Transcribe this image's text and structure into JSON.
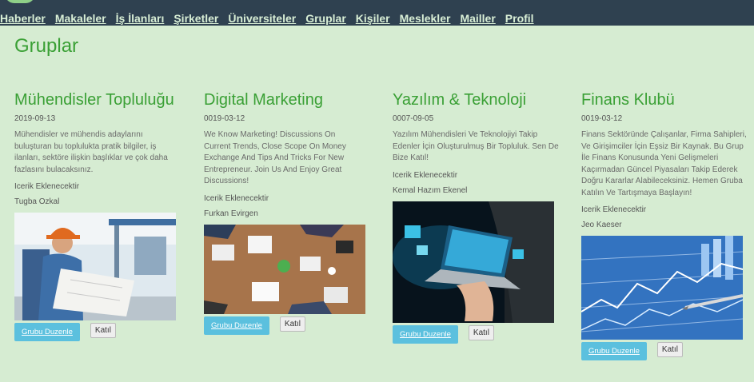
{
  "nav": {
    "items": [
      "Haberler",
      "Makaleler",
      "İş İlanları",
      "Şirketler",
      "Üniversiteler",
      "Gruplar",
      "Kişiler",
      "Meslekler",
      "Mailler",
      "Profil"
    ]
  },
  "page": {
    "title": "Gruplar"
  },
  "buttons": {
    "edit": "Grubu Duzenle",
    "join": "Katıl"
  },
  "groups": [
    {
      "title": "Mühendisler Topluluğu",
      "date": "2019-09-13",
      "description": "Mühendisler ve mühendis adaylarını buluşturan bu toplulukta pratik bilgiler, iş ilanları, sektöre ilişkin başlıklar ve çok daha fazlasını bulacaksınız.",
      "content": "Icerik Eklenecektir",
      "owner": "Tugba Ozkal"
    },
    {
      "title": "Digital Marketing",
      "date": "0019-03-12",
      "description": "We Know Marketing! Discussions On Current Trends, Close Scope On Money Exchange And Tips And Tricks For New Entrepreneur. Join Us And Enjoy Great Discussions!",
      "content": "Icerik Eklenecektir",
      "owner": "Furkan Evirgen"
    },
    {
      "title": "Yazılım & Teknoloji",
      "date": "0007-09-05",
      "description": "Yazılım Mühendisleri Ve Teknolojiyi Takip Edenler İçin Oluşturulmuş Bir Topluluk. Sen De Bize Katıl!",
      "content": "Icerik Eklenecektir",
      "owner": "Kemal Hazım Ekenel"
    },
    {
      "title": "Finans Klubü",
      "date": "0019-03-12",
      "description": "Finans Sektöründe Çalışanlar, Firma Sahipleri, Ve Girişimciler İçin Eşsiz Bir Kaynak. Bu Grup İle Finans Konusunda Yeni Gelişmeleri Kaçırmadan Güncel Piyasaları Takip Ederek Doğru Kararlar Alabileceksiniz. Hemen Gruba Katılın Ve Tartışmaya Başlayın!",
      "content": "Icerik Eklenecektir",
      "owner": "Jeo Kaeser"
    }
  ]
}
